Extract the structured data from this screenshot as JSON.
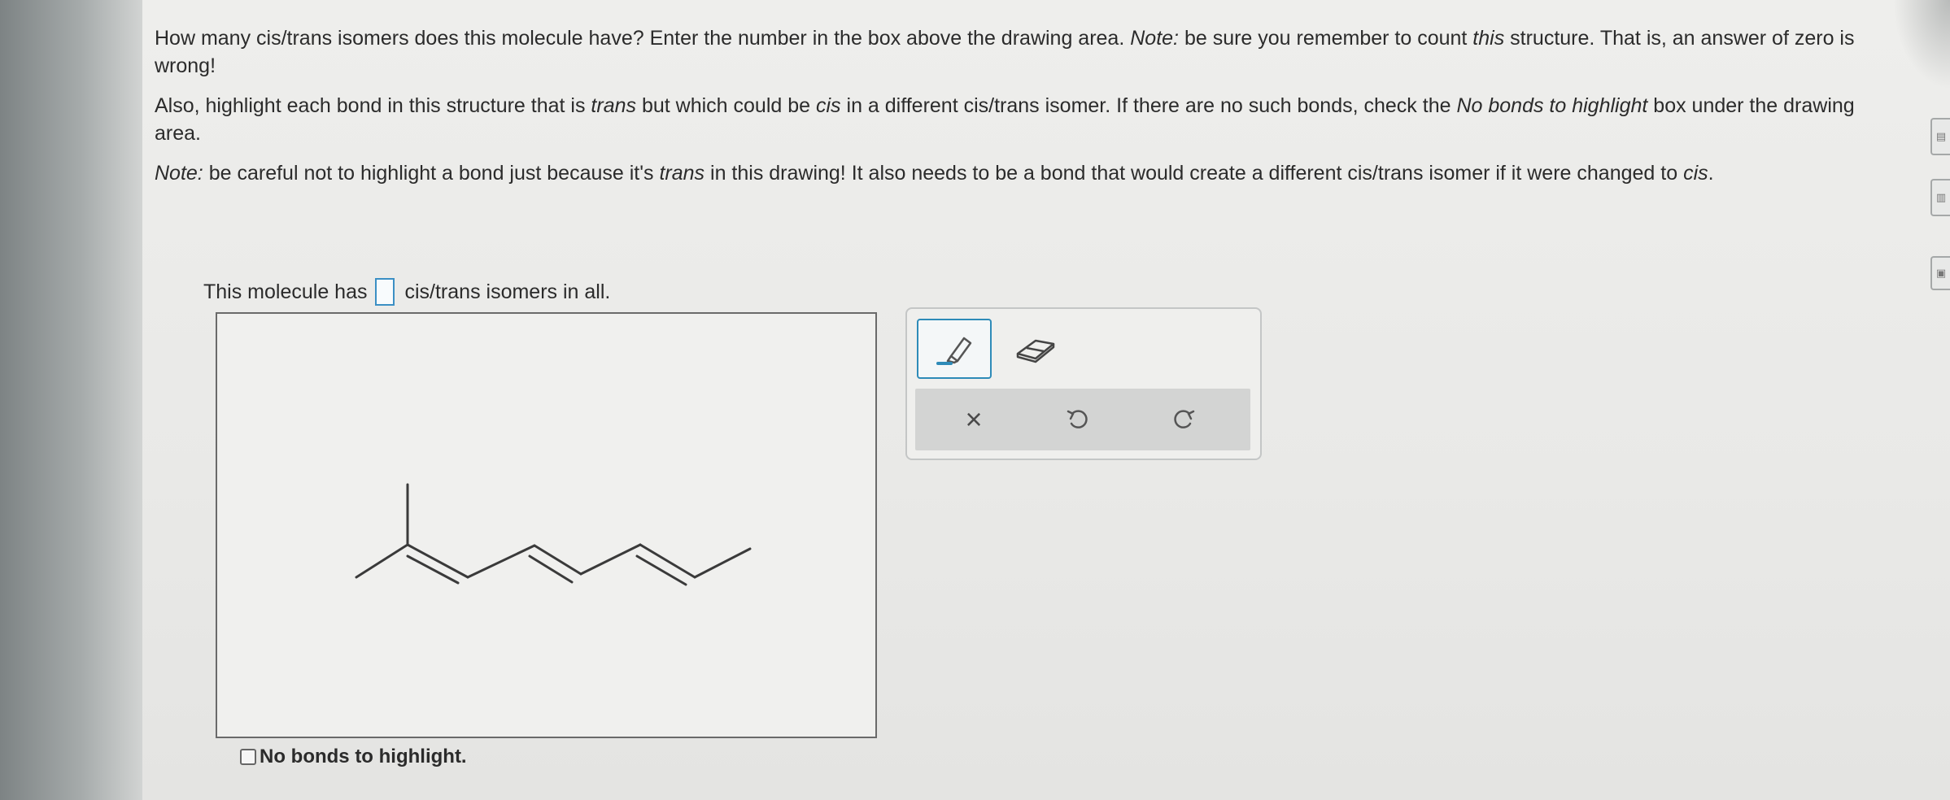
{
  "question": {
    "p1_a": "How many cis/trans isomers does this molecule have? Enter the number in the box above the drawing area. ",
    "p1_note": "Note:",
    "p1_b": " be sure you remember to count ",
    "p1_this": "this",
    "p1_c": " structure. That is, an answer of zero is wrong!",
    "p2_a": "Also, highlight each bond in this structure that is ",
    "p2_trans": "trans",
    "p2_b": " but which could be ",
    "p2_cis": "cis",
    "p2_c": " in a different cis/trans isomer. If there are no such bonds, check the ",
    "p2_nobonds": "No bonds to highlight",
    "p2_d": " box under the drawing area.",
    "p3_note": "Note:",
    "p3_a": " be careful not to highlight a bond just because it's ",
    "p3_trans": "trans",
    "p3_b": " in this drawing! It also needs to be a bond that would create a different cis/trans isomer if it were changed to ",
    "p3_cis": "cis",
    "p3_c": "."
  },
  "answer": {
    "prefix": "This molecule has",
    "value": "",
    "suffix": "cis/trans isomers in all."
  },
  "molecule": {
    "type": "skeletal structure",
    "double_bonds": 3
  },
  "toolbar": {
    "tools": [
      {
        "name": "highlight",
        "icon": "highlighter-icon",
        "selected": true
      },
      {
        "name": "eraser",
        "icon": "eraser-icon",
        "selected": false
      }
    ],
    "actions": [
      {
        "name": "clear",
        "icon": "close-icon",
        "label": "×"
      },
      {
        "name": "undo",
        "icon": "undo-icon"
      },
      {
        "name": "redo",
        "icon": "redo-icon"
      }
    ]
  },
  "no_bonds": {
    "label": "No bonds to highlight.",
    "checked": false
  },
  "colors": {
    "accent": "#2e8bb8",
    "text": "#2b2b2b",
    "bond": "#3a3a3a"
  }
}
